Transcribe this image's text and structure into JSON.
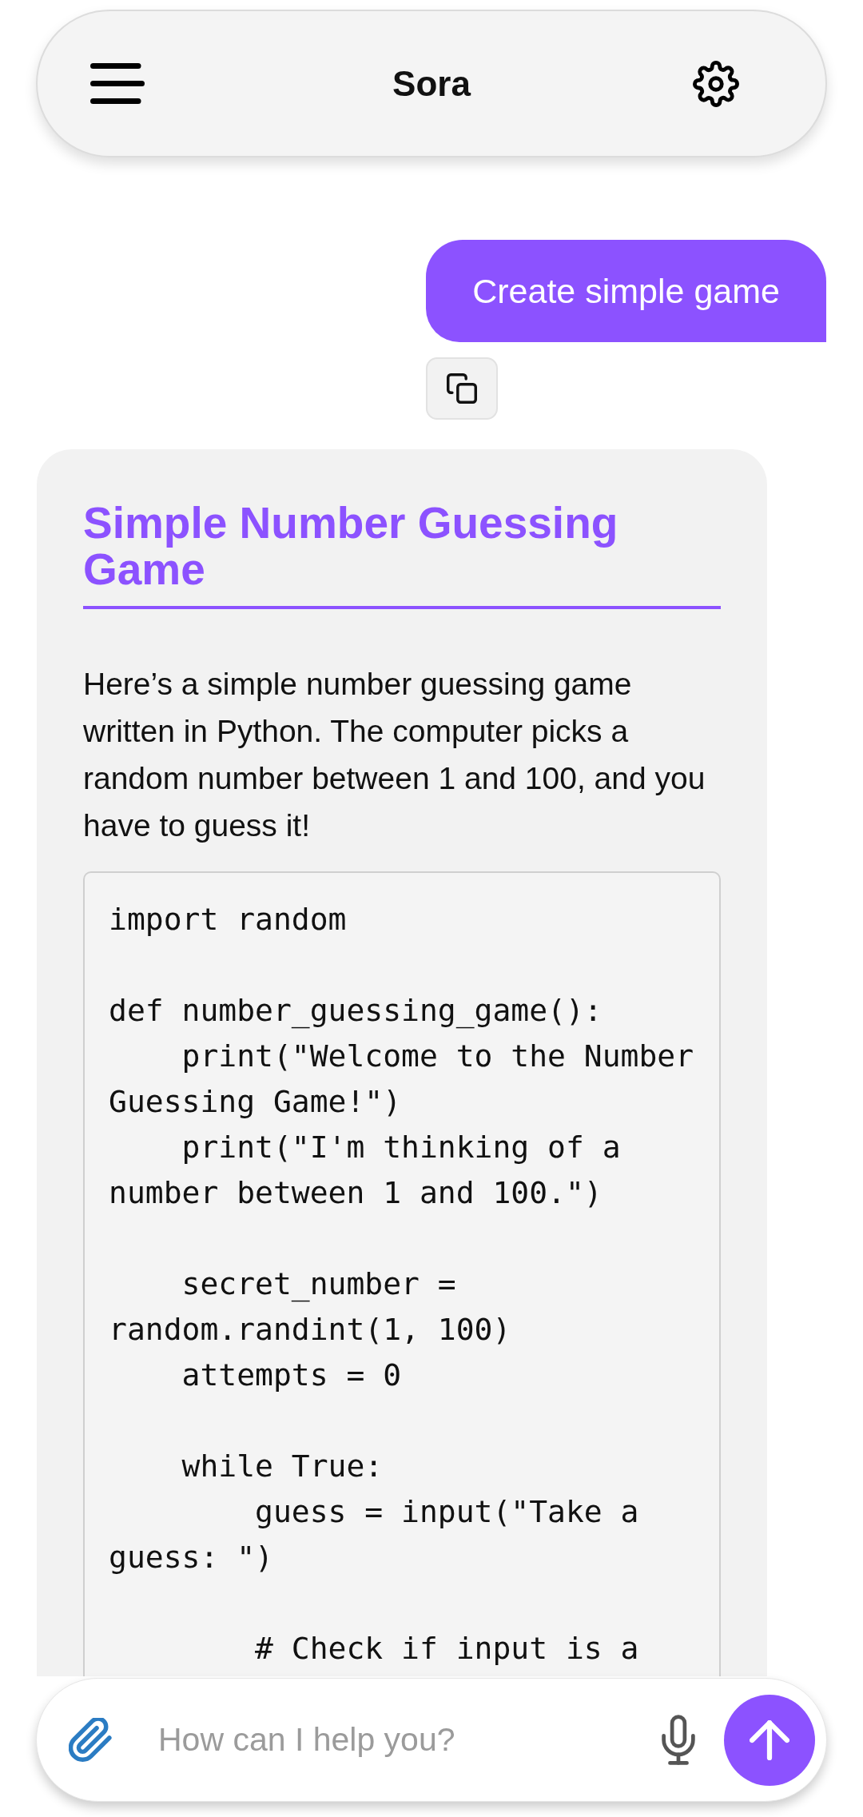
{
  "top_bar": {
    "title": "Sora"
  },
  "messages": [
    {
      "kind": "user",
      "text": "Create simple game"
    },
    {
      "kind": "assistant",
      "heading": "Simple Number Guessing Game",
      "paragraph": "Here’s a simple number guessing game written in Python. The computer picks a random number between 1 and 100, and you have to guess it!",
      "code": "import random\n\ndef number_guessing_game():\n    print(\"Welcome to the Number Guessing Game!\")\n    print(\"I'm thinking of a number between 1 and 100.\")\n\n    secret_number = random.randint(1, 100)\n    attempts = 0\n\n    while True:\n        guess = input(\"Take a guess: \")\n\n        # Check if input is a"
    }
  ],
  "composer": {
    "placeholder": "How can I help you?"
  }
}
